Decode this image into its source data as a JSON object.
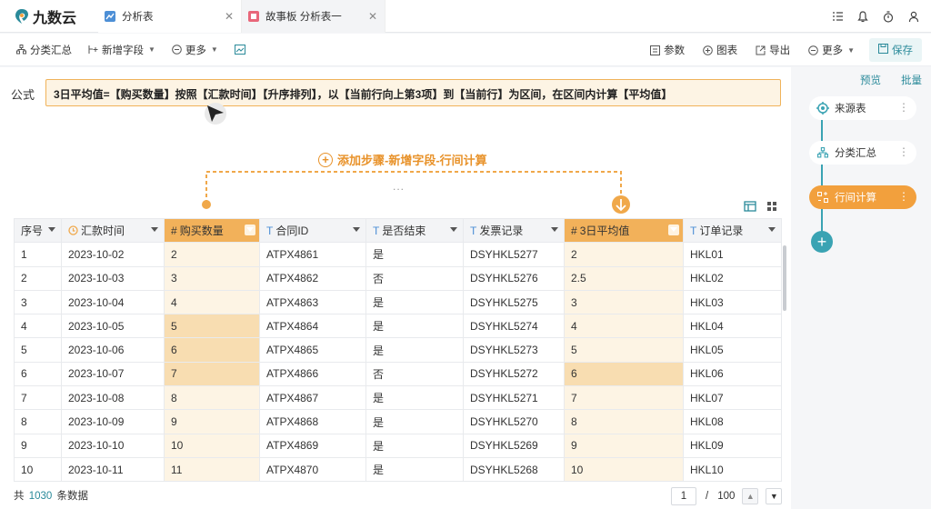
{
  "app": {
    "name": "九数云"
  },
  "tabs": [
    {
      "label": "分析表",
      "active": true
    },
    {
      "label": "故事板 分析表一",
      "active": false
    }
  ],
  "toolbar": {
    "left": [
      {
        "label": "分类汇总",
        "icon": "hierarchy-icon"
      },
      {
        "label": "新增字段",
        "icon": "add-field-icon",
        "dropdown": true
      },
      {
        "label": "更多",
        "icon": "more-circle-icon",
        "dropdown": true
      }
    ],
    "right": [
      {
        "label": "参数",
        "icon": "param-icon"
      },
      {
        "label": "图表",
        "icon": "chart-icon"
      },
      {
        "label": "导出",
        "icon": "export-icon"
      },
      {
        "label": "更多",
        "icon": "more-circle-icon",
        "dropdown": true
      }
    ],
    "save_label": "保存"
  },
  "formula": {
    "label": "公式",
    "text": "3日平均值=【购买数量】按照【汇款时间】【升序排列】，以【当前行向上第3项】到【当前行】为区间，在区间内计算【平均值】"
  },
  "step": {
    "label": "添加步骤-新增字段-行间计算",
    "ellipsis": "..."
  },
  "table": {
    "columns": [
      {
        "label": "序号",
        "type": "",
        "highlight": false
      },
      {
        "label": "汇款时间",
        "type": "clock",
        "highlight": false
      },
      {
        "label": "购买数量",
        "type": "#",
        "highlight": true
      },
      {
        "label": "合同ID",
        "type": "T",
        "highlight": false
      },
      {
        "label": "是否结束",
        "type": "T",
        "highlight": false
      },
      {
        "label": "发票记录",
        "type": "T",
        "highlight": false
      },
      {
        "label": "3日平均值",
        "type": "#",
        "highlight": true
      },
      {
        "label": "订单记录",
        "type": "T",
        "highlight": false
      }
    ],
    "rows": [
      [
        "1",
        "2023-10-02",
        "2",
        "ATPX4861",
        "是",
        "DSYHKL5277",
        "2",
        "HKL01"
      ],
      [
        "2",
        "2023-10-03",
        "3",
        "ATPX4862",
        "否",
        "DSYHKL5276",
        "2.5",
        "HKL02"
      ],
      [
        "3",
        "2023-10-04",
        "4",
        "ATPX4863",
        "是",
        "DSYHKL5275",
        "3",
        "HKL03"
      ],
      [
        "4",
        "2023-10-05",
        "5",
        "ATPX4864",
        "是",
        "DSYHKL5274",
        "4",
        "HKL04"
      ],
      [
        "5",
        "2023-10-06",
        "6",
        "ATPX4865",
        "是",
        "DSYHKL5273",
        "5",
        "HKL05"
      ],
      [
        "6",
        "2023-10-07",
        "7",
        "ATPX4866",
        "否",
        "DSYHKL5272",
        "6",
        "HKL06"
      ],
      [
        "7",
        "2023-10-08",
        "8",
        "ATPX4867",
        "是",
        "DSYHKL5271",
        "7",
        "HKL07"
      ],
      [
        "8",
        "2023-10-09",
        "9",
        "ATPX4868",
        "是",
        "DSYHKL5270",
        "8",
        "HKL08"
      ],
      [
        "9",
        "2023-10-10",
        "10",
        "ATPX4869",
        "是",
        "DSYHKL5269",
        "9",
        "HKL09"
      ],
      [
        "10",
        "2023-10-11",
        "11",
        "ATPX4870",
        "是",
        "DSYHKL5268",
        "10",
        "HKL10"
      ]
    ]
  },
  "footer": {
    "prefix": "共",
    "count": "1030",
    "suffix": "条数据"
  },
  "pager": {
    "current": "1",
    "separator": "/",
    "total": "100"
  },
  "right_panel": {
    "links": [
      "预览",
      "批量"
    ],
    "nodes": [
      {
        "label": "来源表",
        "icon": "source-table-icon",
        "active": false
      },
      {
        "label": "分类汇总",
        "icon": "hierarchy-icon",
        "active": false
      },
      {
        "label": "行间计算",
        "icon": "row-calc-icon",
        "active": true
      }
    ]
  },
  "colors": {
    "accent": "#2a8a9a",
    "highlight": "#f2b15a",
    "step": "#e8922a",
    "node_active": "#f2a03d"
  }
}
